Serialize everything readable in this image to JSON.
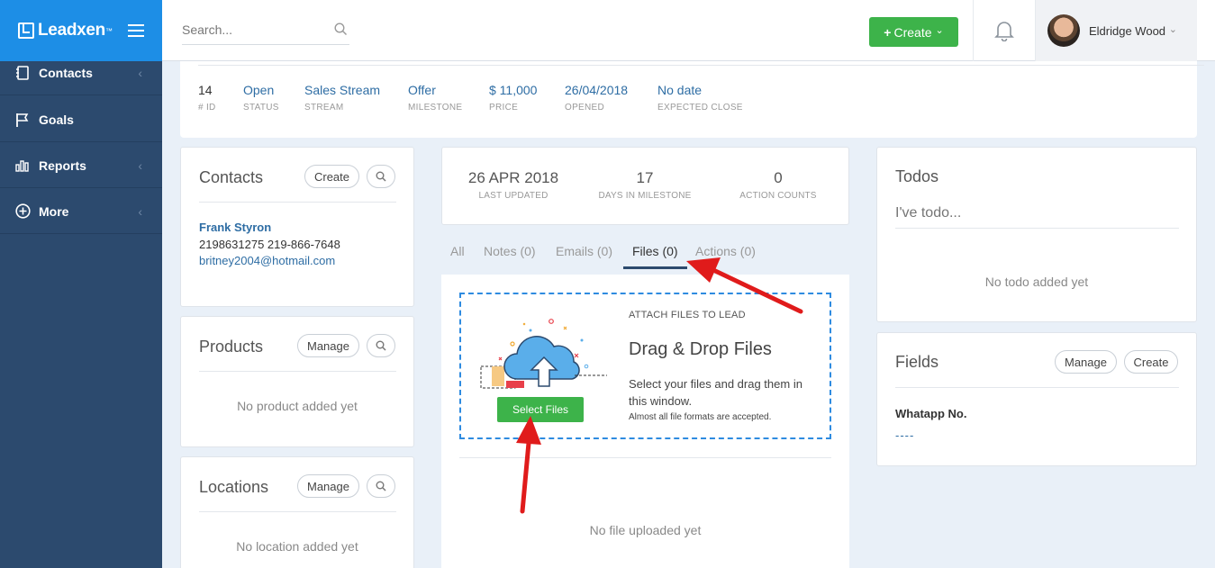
{
  "brand": {
    "name": "Leadxen",
    "tm": "™"
  },
  "sidebar": {
    "items": [
      {
        "label": "Contacts",
        "icon": "address-book-icon",
        "has_chevron": true
      },
      {
        "label": "Goals",
        "icon": "flag-icon",
        "has_chevron": false
      },
      {
        "label": "Reports",
        "icon": "bar-chart-icon",
        "has_chevron": true
      },
      {
        "label": "More",
        "icon": "plus-circle-icon",
        "has_chevron": true
      }
    ],
    "chevron": "‹"
  },
  "topbar": {
    "search_placeholder": "Search...",
    "create_label": "Create",
    "create_plus": "+",
    "create_caret": "⌄",
    "user_name": "Eldridge Wood",
    "user_caret": "⌄"
  },
  "lead": {
    "stats": [
      {
        "value": "14",
        "label": "# ID"
      },
      {
        "value": "Open",
        "label": "STATUS"
      },
      {
        "value": "Sales Stream",
        "label": "STREAM"
      },
      {
        "value": "Offer",
        "label": "MILESTONE"
      },
      {
        "value": "$ 11,000",
        "label": "PRICE"
      },
      {
        "value": "26/04/2018",
        "label": "OPENED"
      },
      {
        "value": "No date",
        "label": "EXPECTED CLOSE"
      }
    ]
  },
  "contacts_card": {
    "title": "Contacts",
    "create_label": "Create",
    "contact": {
      "name": "Frank Styron",
      "phones": "2198631275 219-866-7648",
      "email": "britney2004@hotmail.com"
    }
  },
  "products_card": {
    "title": "Products",
    "manage_label": "Manage",
    "empty": "No product added yet"
  },
  "locations_card": {
    "title": "Locations",
    "manage_label": "Manage",
    "empty": "No location added yet"
  },
  "summary": {
    "stats": [
      {
        "value": "26 APR 2018",
        "label": "LAST UPDATED"
      },
      {
        "value": "17",
        "label": "DAYS IN MILESTONE"
      },
      {
        "value": "0",
        "label": "ACTION COUNTS"
      }
    ]
  },
  "tabs": [
    {
      "label": "All"
    },
    {
      "label": "Notes (0)"
    },
    {
      "label": "Emails (0)"
    },
    {
      "label": "Files (0)"
    },
    {
      "label": "Actions (0)"
    }
  ],
  "active_tab": "Files (0)",
  "files": {
    "heading_small": "ATTACH FILES TO LEAD",
    "title": "Drag & Drop Files",
    "description": "Select your files and drag them in this window.",
    "note": "Almost all file formats are accepted.",
    "select_label": "Select Files",
    "empty": "No file uploaded yet"
  },
  "todos_card": {
    "title": "Todos",
    "placeholder": "I've todo...",
    "empty": "No todo added yet"
  },
  "fields_card": {
    "title": "Fields",
    "manage_label": "Manage",
    "create_label": "Create",
    "field_label": "Whatapp No.",
    "field_value": "----"
  },
  "colors": {
    "sidebar": "#2c4a6e",
    "brand_blue": "#1d8ee6",
    "green": "#3db34a",
    "link": "#2e6da4",
    "annotation_arrow": "#e01b1b"
  }
}
